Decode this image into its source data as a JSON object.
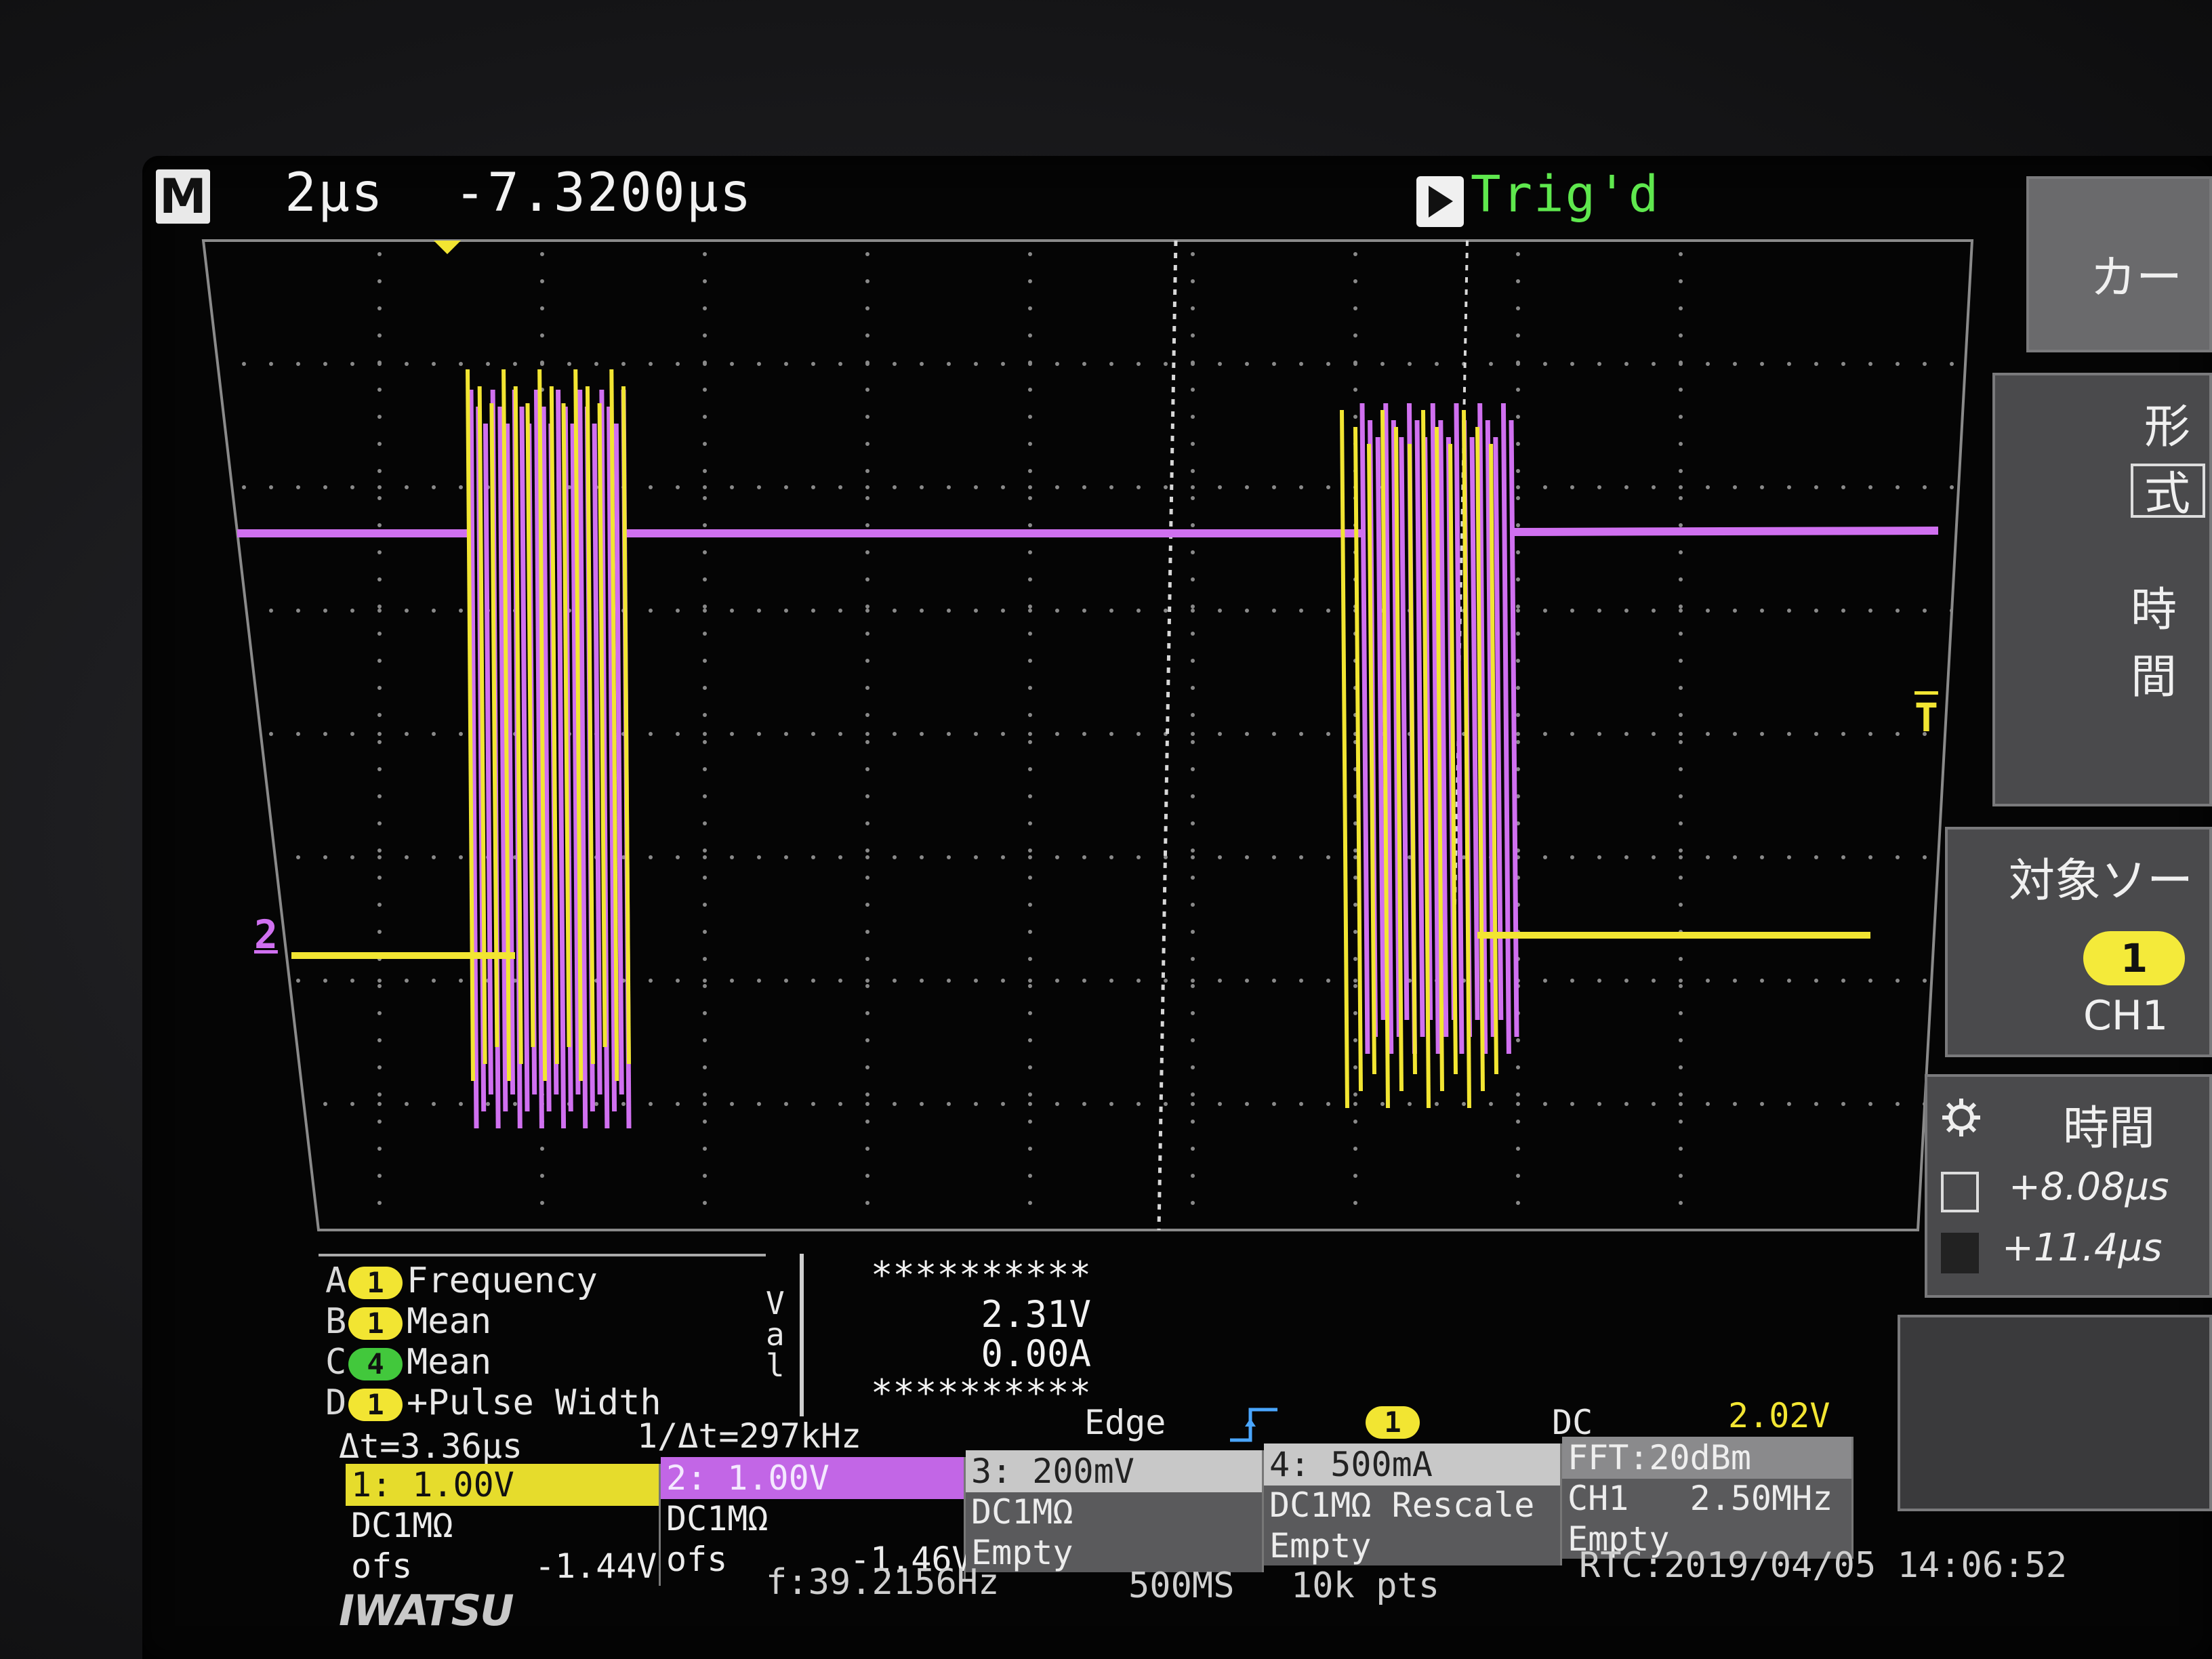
{
  "colors": {
    "ch1": "#f2e532",
    "ch2": "#d070f0",
    "ch4": "#42c83c",
    "trig": "#5fe84e",
    "grid": "#9a9a9a"
  },
  "topbar": {
    "mode_badge": "M",
    "timebase": "2µs",
    "delay": "-7.3200µs",
    "trigger_status": "Trig'd"
  },
  "markers": {
    "ch2_marker": "2",
    "trigger_level_marker": "T"
  },
  "menu": {
    "item1_label": "カー",
    "item2_label": "形式",
    "item2_sub": "時間",
    "item3_label": "対象ソー",
    "item3_pill": "1",
    "item3_value": "CH1",
    "item4_label": "時間",
    "cursor1_value": "+8.08µs",
    "cursor2_value": "+11.4µs"
  },
  "measurements": [
    {
      "letter": "A",
      "channel": "1",
      "name": "Frequency",
      "value": "**********"
    },
    {
      "letter": "B",
      "channel": "1",
      "name": "Mean",
      "value": "2.31V"
    },
    {
      "letter": "C",
      "channel": "4",
      "name": "Mean",
      "value": "0.00A"
    },
    {
      "letter": "D",
      "channel": "1",
      "name": "+Pulse Width",
      "value": "**********"
    }
  ],
  "val_label": "Val",
  "cursor_readout": {
    "delta_t": "Δt=3.36µs",
    "inv_delta_t": "1/Δt=297kHz"
  },
  "trigger": {
    "type": "Edge",
    "source": "1",
    "coupling": "DC",
    "level": "2.02V"
  },
  "channels": [
    {
      "head": "1: 1.00V",
      "line1": "DC1MΩ",
      "line2": "ofs      -1.44V"
    },
    {
      "head": "2: 1.00V",
      "line1": "DC1MΩ",
      "line2": "ofs      -1.46V"
    },
    {
      "head": "3: 200mV",
      "line1": "DC1MΩ",
      "line2": "Empty"
    },
    {
      "head": "4: 500mA",
      "line1": "DC1MΩ Rescale",
      "line2": "Empty"
    },
    {
      "head": "FFT:20dBm",
      "line1": "CH1   2.50MHz",
      "line2": "Empty"
    }
  ],
  "footer": {
    "brand": "IWATSU",
    "freq": "f:39.2156Hz",
    "sample_rate": "500MS",
    "points": "10k pts",
    "rtc": "RTC:2019/04/05 14:06:52"
  }
}
